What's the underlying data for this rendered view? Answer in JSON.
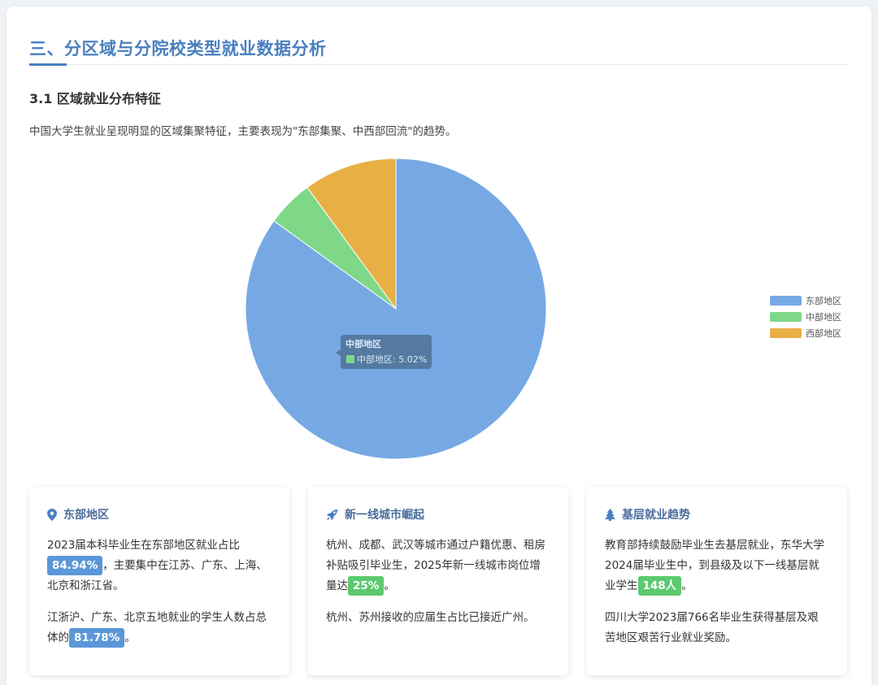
{
  "section": {
    "title": "三、分区域与分院校类型就业数据分析",
    "subtitle": "3.1 区域就业分布特征",
    "intro": "中国大学生就业呈现明显的区域集聚特征，主要表现为\"东部集聚、中西部回流\"的趋势。"
  },
  "chart_data": {
    "type": "pie",
    "title": "",
    "categories": [
      "东部地区",
      "中部地区",
      "西部地区"
    ],
    "values": [
      84.94,
      5.02,
      10.04
    ],
    "colors": [
      "#76a9e4",
      "#7ed888",
      "#e8af45"
    ],
    "legend_position": "right",
    "tooltip": {
      "title": "中部地区",
      "text": "中部地区: 5.02%"
    }
  },
  "cards": [
    {
      "title": "东部地区",
      "icon": "map-pin-icon",
      "p1": {
        "pre": "2023届本科毕业生在东部地区就业占比",
        "hl": "84.94%",
        "post": "，主要集中在江苏、广东、上海、北京和浙江省。"
      },
      "p2": {
        "pre": "江浙沪、广东、北京五地就业的学生人数占总体的",
        "hl": "81.78%",
        "post": "。"
      }
    },
    {
      "title": "新一线城市崛起",
      "icon": "rocket-icon",
      "p1": {
        "pre": "杭州、成都、武汉等城市通过户籍优惠、租房补贴吸引毕业生，2025年新一线城市岗位增量达",
        "hl": "25%",
        "post": "。"
      },
      "p2": {
        "text": "杭州、苏州接收的应届生占比已接近广州。"
      }
    },
    {
      "title": "基层就业趋势",
      "icon": "tree-icon",
      "p1": {
        "pre": "教育部持续鼓励毕业生去基层就业，东华大学2024届毕业生中，到县级及以下一线基层就业学生",
        "hl": "148人",
        "post": "。"
      },
      "p2": {
        "text": "四川大学2023届766名毕业生获得基层及艰苦地区艰苦行业就业奖励。"
      }
    }
  ]
}
